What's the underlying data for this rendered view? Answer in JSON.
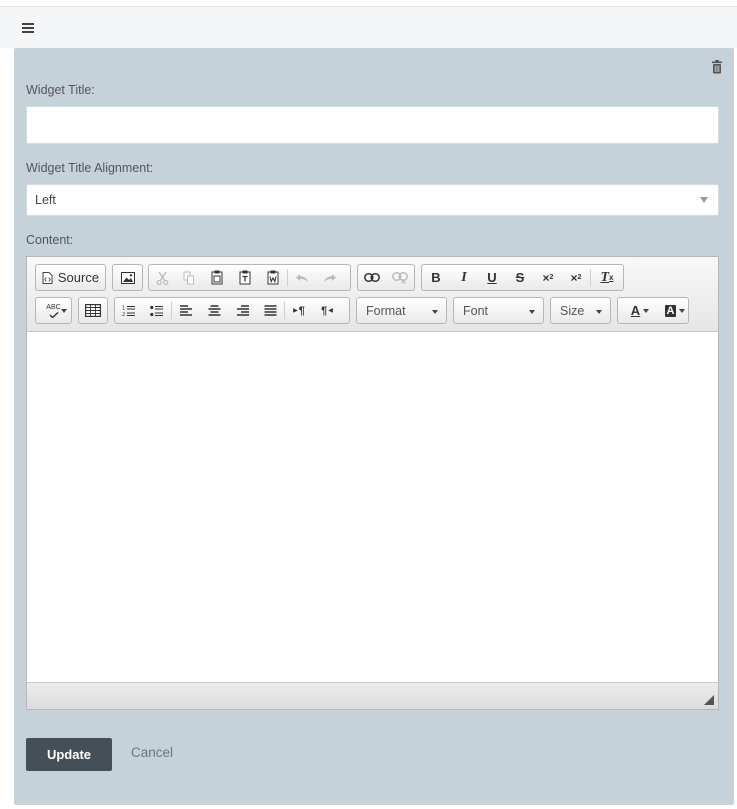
{
  "widget_form": {
    "title_label": "Widget Title:",
    "title_value": "",
    "alignment_label": "Widget Title Alignment:",
    "alignment_value": "Left",
    "content_label": "Content:",
    "update_label": "Update",
    "cancel_label": "Cancel"
  },
  "editor_toolbar": {
    "source_label": "Source",
    "format_label": "Format",
    "font_label": "Font",
    "size_label": "Size",
    "spellcheck_label": "ABC",
    "text_color_label": "A",
    "bg_color_label": "A"
  },
  "icons": {
    "menu": "hamburger-icon",
    "delete": "trash-icon",
    "resize": "resize-grip-icon"
  },
  "colors": {
    "panel_bg": "#c6d2d9",
    "update_button": "#454f58"
  }
}
